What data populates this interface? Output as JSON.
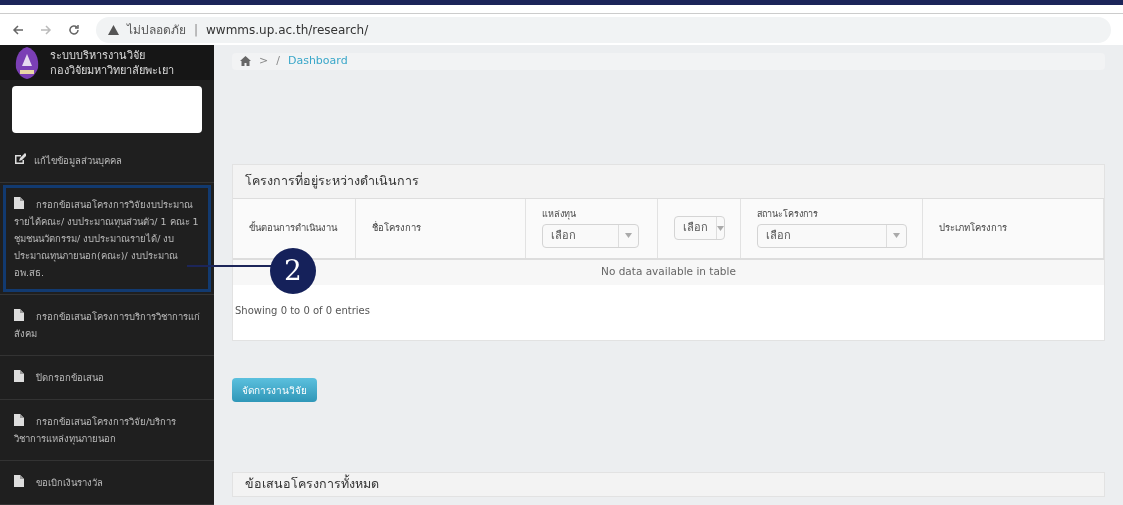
{
  "browser": {
    "security_label": "ไม่ปลอดภัย",
    "divider": "|",
    "url": "wwmms.up.ac.th/research/"
  },
  "sidebar": {
    "title_lines": [
      "ระบบบริหารงานวิจัย",
      "กองวิจัยมหาวิทยาลัยพะเยา"
    ],
    "items": [
      {
        "kind": "edit",
        "label": "แก้ไขข้อมูลส่วนบุคคล",
        "highlighted": false
      },
      {
        "kind": "file",
        "label": "กรอกข้อเสนอโครงการวิจัยงบประมาณรายได้คณะ/ งบประมาณทุนส่วนตัว/ 1 คณะ 1 ชุมชนนวัตกรรม/ งบประมาณรายได้/ งบประมาณทุนภายนอก(คณะ)/ งบประมาณ อพ.สธ.",
        "highlighted": true
      },
      {
        "kind": "file",
        "label": "กรอกข้อเสนอโครงการบริการวิชาการแก่สังคม",
        "highlighted": false
      },
      {
        "kind": "file",
        "label": "ปิดกรอกข้อเสนอ",
        "highlighted": false
      },
      {
        "kind": "file",
        "label": "กรอกข้อเสนอโครงการวิจัย/บริการวิชาการแหล่งทุนภายนอก",
        "highlighted": false
      },
      {
        "kind": "file",
        "label": "ขอเบิกเงินรางวัล",
        "highlighted": false
      }
    ]
  },
  "breadcrumb": {
    "separator": ">",
    "slash": "/",
    "current": "Dashboard"
  },
  "panel": {
    "title": "โครงการที่อยู่ระหว่างดำเนินการ",
    "columns": [
      {
        "kind": "text",
        "label": "ขั้นตอนการดำเนินงาน"
      },
      {
        "kind": "text",
        "label": "ชื่อโครงการ"
      },
      {
        "kind": "filter",
        "label": "แหล่งทุน",
        "select": "เลือก"
      },
      {
        "kind": "select",
        "select": "เลือก"
      },
      {
        "kind": "filter",
        "label": "สถานะโครงการ",
        "select": "เลือก"
      },
      {
        "kind": "text",
        "label": "ประเภทโครงการ"
      }
    ],
    "empty_message": "No data available in table",
    "info": "Showing 0 to 0 of 0 entries"
  },
  "button": "จัดการงานวิจัย",
  "panel_2": {
    "title": "ข้อเสนอโครงการทั้งหมด"
  },
  "callout": {
    "number": "2"
  }
}
